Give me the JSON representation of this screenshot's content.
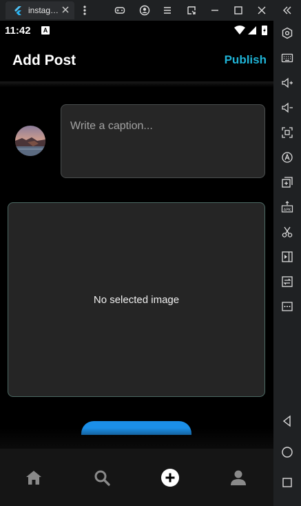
{
  "emulator": {
    "tab_title": "instag…",
    "toolbar_icons": [
      "gamepad-icon",
      "account-icon",
      "menu-icon",
      "resize-icon",
      "minimize-icon",
      "maximize-icon",
      "close-icon",
      "collapse-icon"
    ],
    "sidebar_icons": [
      "settings-icon",
      "keyboard-icon",
      "volume-up-icon",
      "volume-down-icon",
      "screenshot-icon",
      "rotate-icon",
      "multi-instance-icon",
      "apk-install-icon",
      "cut-icon",
      "media-icon",
      "sync-icon",
      "more-icon",
      "back-icon",
      "home-icon",
      "recents-icon"
    ]
  },
  "status_bar": {
    "time": "11:42",
    "notification_badge": "A",
    "icons": [
      "wifi-icon",
      "signal-icon",
      "battery-icon"
    ]
  },
  "app_bar": {
    "title": "Add Post",
    "publish_label": "Publish",
    "accent_color": "#1fb3d6"
  },
  "caption": {
    "placeholder": "Write a caption...",
    "value": ""
  },
  "image_preview": {
    "empty_text": "No selected image"
  },
  "bottom_nav": {
    "items": [
      "home-icon",
      "search-icon",
      "add-icon",
      "profile-icon"
    ],
    "active": "add-icon"
  }
}
